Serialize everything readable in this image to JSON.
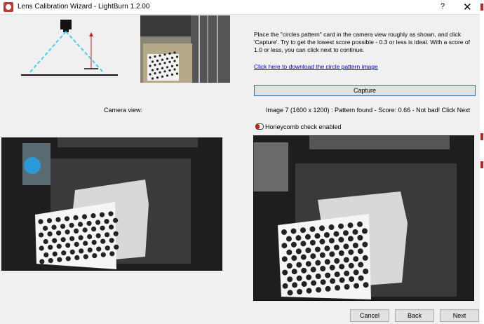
{
  "window": {
    "title": "Lens Calibration Wizard - LightBurn 1.2.00",
    "help_glyph": "?",
    "close_glyph": "✕"
  },
  "instructions": {
    "text": "Place the \"circles pattern\" card in the camera view roughly as shown, and click 'Capture'. Try to get the lowest score possible - 0.3 or less is ideal.  With a score of 1.0 or less, you can click next to continue.",
    "download_link": "Click here to download the circle pattern image"
  },
  "capture": {
    "label": "Capture"
  },
  "camera": {
    "view_label": "Camera view:",
    "status": "Image 7 (1600 x 1200) : Pattern found - Score: 0.66 - Not bad! Click Next"
  },
  "honeycomb": {
    "label": "Honeycomb check enabled",
    "enabled": true
  },
  "buttons": {
    "cancel": "Cancel",
    "back": "Back",
    "next": "Next"
  },
  "colors": {
    "accent": "#3a6fb0",
    "link": "#0000ee",
    "toggle_on": "#cc2200",
    "camera_cone": "#40d0f0",
    "height_arrow": "#cc2222",
    "camera_frame": "#1e1e1e",
    "card": "#f5f5f5",
    "dot": "#222222"
  }
}
